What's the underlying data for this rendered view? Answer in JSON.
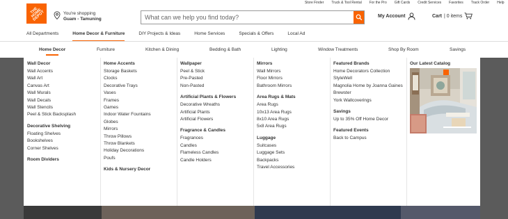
{
  "utility_links": [
    "Store Finder",
    "Truck & Tool Rental",
    "For the Pro",
    "Gift Cards",
    "Credit Services",
    "Favorites",
    "Track Order",
    "Help"
  ],
  "logo": {
    "text": "THE HOME DEPOT",
    "color": "#f96302"
  },
  "store": {
    "label": "You're shopping",
    "name": "Guam - Tamuning",
    "icon": "location-pin-icon"
  },
  "search": {
    "placeholder": "What can we help you find today?",
    "icon": "search-icon"
  },
  "account": {
    "label": "My Account",
    "icon": "user-icon"
  },
  "cart": {
    "label": "Cart",
    "count": "| 0 items",
    "icon": "cart-icon"
  },
  "main_nav": [
    {
      "label": "All Departments",
      "active": false
    },
    {
      "label": "Home Decor & Furniture",
      "active": true
    },
    {
      "label": "DIY Projects & Ideas",
      "active": false
    },
    {
      "label": "Home Services",
      "active": false
    },
    {
      "label": "Specials & Offers",
      "active": false
    },
    {
      "label": "Local Ad",
      "active": false
    }
  ],
  "sub_nav": [
    "Home Decor",
    "Furniture",
    "Kitchen & Dining",
    "Bedding & Bath",
    "Lighting",
    "Window Treatments",
    "Shop By Room",
    "Savings"
  ],
  "menu": {
    "col1": {
      "g1": {
        "title": "Wall Decor",
        "items": [
          "Wall Accents",
          "Wall Art",
          "Canvas Art",
          "Wall Murals",
          "Wall Decals",
          "Wall Stencils",
          "Peel & Stick Backsplash"
        ]
      },
      "g2": {
        "title": "Decorative Shelving",
        "items": [
          "Floating Shelves",
          "Bookshelves",
          "Corner Shelves"
        ]
      },
      "g3": {
        "title": "Room Dividers"
      }
    },
    "col2": {
      "g1": {
        "title": "Home Accents",
        "items": [
          "Storage Baskets",
          "Clocks",
          "Decorative Trays",
          "Vases",
          "Frames",
          "Games",
          "Indoor Water Fountains",
          "Globes",
          "Mirrors",
          "Throw Pillows",
          "Throw Blankets",
          "Holiday Decorations",
          "Poufs"
        ]
      },
      "g2": {
        "title": "Kids & Nursery Decor"
      }
    },
    "col3": {
      "g1": {
        "title": "Wallpaper",
        "items": [
          "Peel & Stick",
          "Pre-Pasted",
          "Non-Pasted"
        ]
      },
      "g2": {
        "title": "Artificial Plants & Flowers",
        "items": [
          "Decorative Wreaths",
          "Artificial Plants",
          "Artificial Flowers"
        ]
      },
      "g3": {
        "title": "Fragrance & Candles",
        "items": [
          "Fragrances",
          "Candles",
          "Flameless Candles",
          "Candle Holders"
        ]
      }
    },
    "col4": {
      "g1": {
        "title": "Mirrors",
        "items": [
          "Wall Mirrors",
          "Floor Mirrors",
          "Bathroom Mirrors"
        ]
      },
      "g2": {
        "title": "Area Rugs & Mats",
        "items": [
          "Area Rugs",
          "10x13 Area Rugs",
          "8x10 Area Rugs",
          "5x8 Area Rugs"
        ]
      },
      "g3": {
        "title": "Luggage",
        "items": [
          "Suitcases",
          "Luggage Sets",
          "Backpacks",
          "Travel Accessories"
        ]
      }
    },
    "col5": {
      "g1": {
        "title": "Featured Brands",
        "items": [
          "Home Decorators Collection",
          "StyleWell",
          "Magnolia Home by Joanna Gaines",
          "Brewster",
          "York Wallcoverings"
        ]
      },
      "g2": {
        "title": "Savings",
        "items": [
          "Up to 35% Off Home Decor"
        ]
      },
      "g3": {
        "title": "Featured Events",
        "items": [
          "Back to Campus"
        ]
      }
    },
    "col6": {
      "title": "Our Latest Catalog"
    }
  }
}
